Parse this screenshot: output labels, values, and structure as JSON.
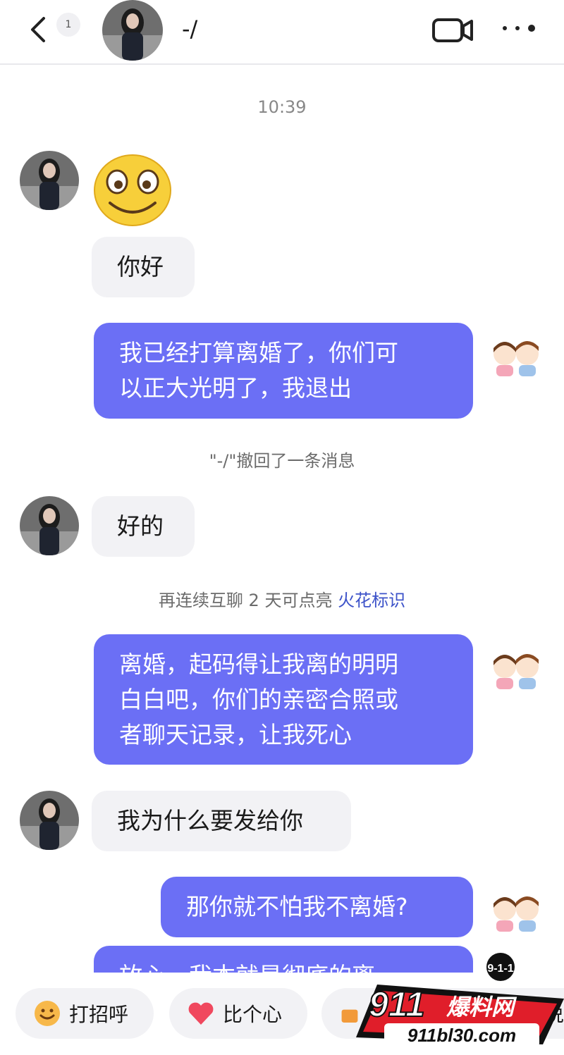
{
  "header": {
    "back_label": "返回",
    "unread_count": "1",
    "contact_name": "-/",
    "video_icon": "video-call-icon",
    "more_icon": "more-dots-icon"
  },
  "chat": {
    "timestamp": "10:39",
    "messages": [
      {
        "side": "left",
        "type": "emoji",
        "icon": "smiling-face-emoji"
      },
      {
        "side": "left",
        "text": "你好"
      },
      {
        "side": "right",
        "text": "我已经打算离婚了，你们可\n以正大光明了，我退出"
      },
      {
        "side": "system",
        "text": "\"-/\"撤回了一条消息"
      },
      {
        "side": "left",
        "text": "好的"
      },
      {
        "side": "system",
        "text": "再连续互聊 2 天可点亮 ",
        "link": "火花标识"
      },
      {
        "side": "right",
        "text": "离婚，起码得让我离的明明\n白白吧，你们的亲密合照或\n者聊天记录，让我死心"
      },
      {
        "side": "left",
        "text": "我为什么要发给你"
      },
      {
        "side": "right",
        "text": "那你就不怕我不离婚?"
      },
      {
        "side": "right",
        "text": "放心，我本就是彻底的离"
      }
    ]
  },
  "quick_replies": [
    {
      "label": "打招呼",
      "icon": "wave-emoji-icon"
    },
    {
      "label": "比个心",
      "icon": "heart-icon"
    },
    {
      "label": "说",
      "icon": "gift-icon"
    }
  ],
  "watermark": {
    "top": "9-1-1",
    "brand": "911",
    "brand_cn": "爆料网",
    "url": "911bl30.com"
  },
  "colors": {
    "accent": "#6b6ff5",
    "link": "#3d53c9",
    "bubble_gray": "#f2f2f5"
  }
}
